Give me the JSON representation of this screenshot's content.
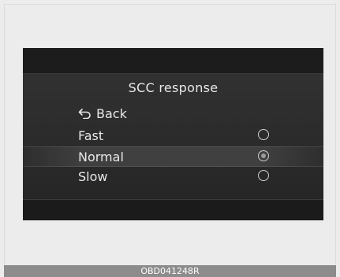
{
  "menu": {
    "title": "SCC response",
    "back_label": "Back",
    "options": [
      {
        "label": "Fast",
        "selected": false
      },
      {
        "label": "Normal",
        "selected": true
      },
      {
        "label": "Slow",
        "selected": false
      }
    ]
  },
  "caption": "OBD041248R"
}
